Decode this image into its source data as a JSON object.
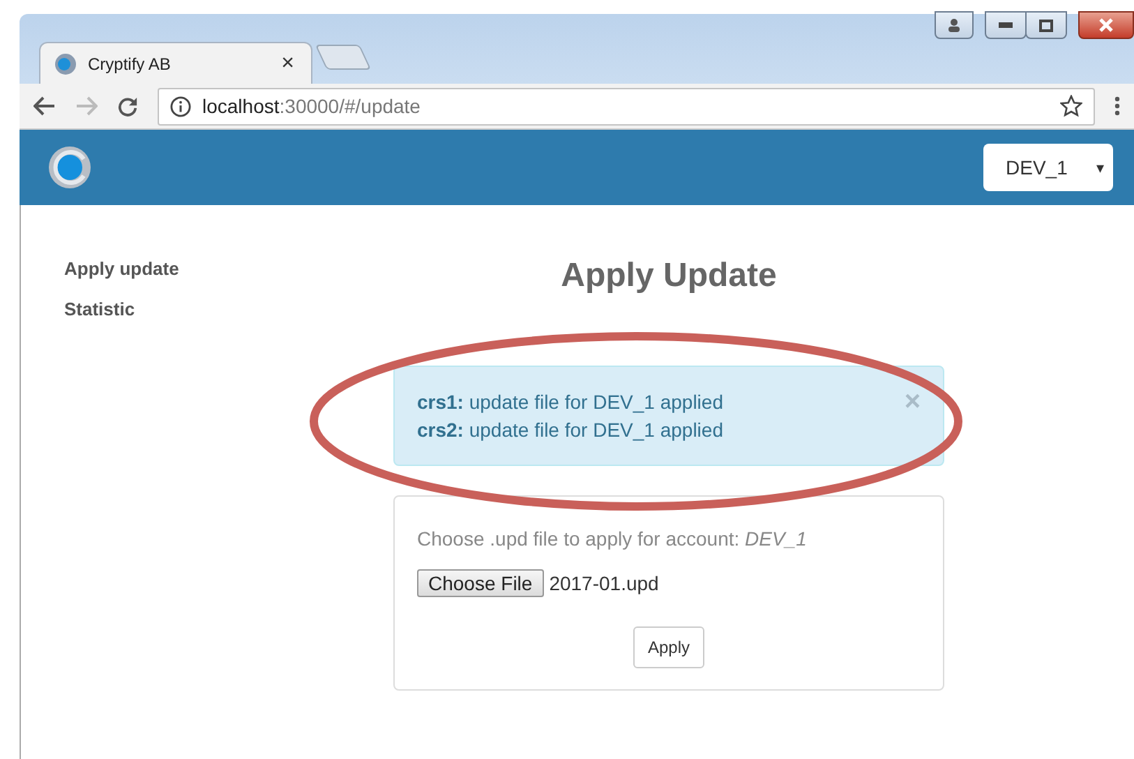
{
  "browser": {
    "tab": {
      "title": "Cryptify AB",
      "close": "×"
    },
    "address": {
      "host": "localhost",
      "rest": ":30000/#/update"
    }
  },
  "header": {
    "account_select": {
      "value": "DEV_1",
      "caret": "▾"
    }
  },
  "sidebar": {
    "items": [
      {
        "label": "Apply update"
      },
      {
        "label": "Statistic"
      }
    ]
  },
  "main": {
    "title": "Apply Update",
    "alert": {
      "messages": [
        "**crs1:** update file for DEV_1 applied",
        "**crs2:** update file for DEV_1 applied"
      ],
      "close": "×"
    },
    "upload": {
      "instruction": "Choose .upd file to apply for account: *DEV_1*",
      "file_button": "Choose File",
      "file_name": "2017-01.upd",
      "submit": "Apply"
    }
  }
}
